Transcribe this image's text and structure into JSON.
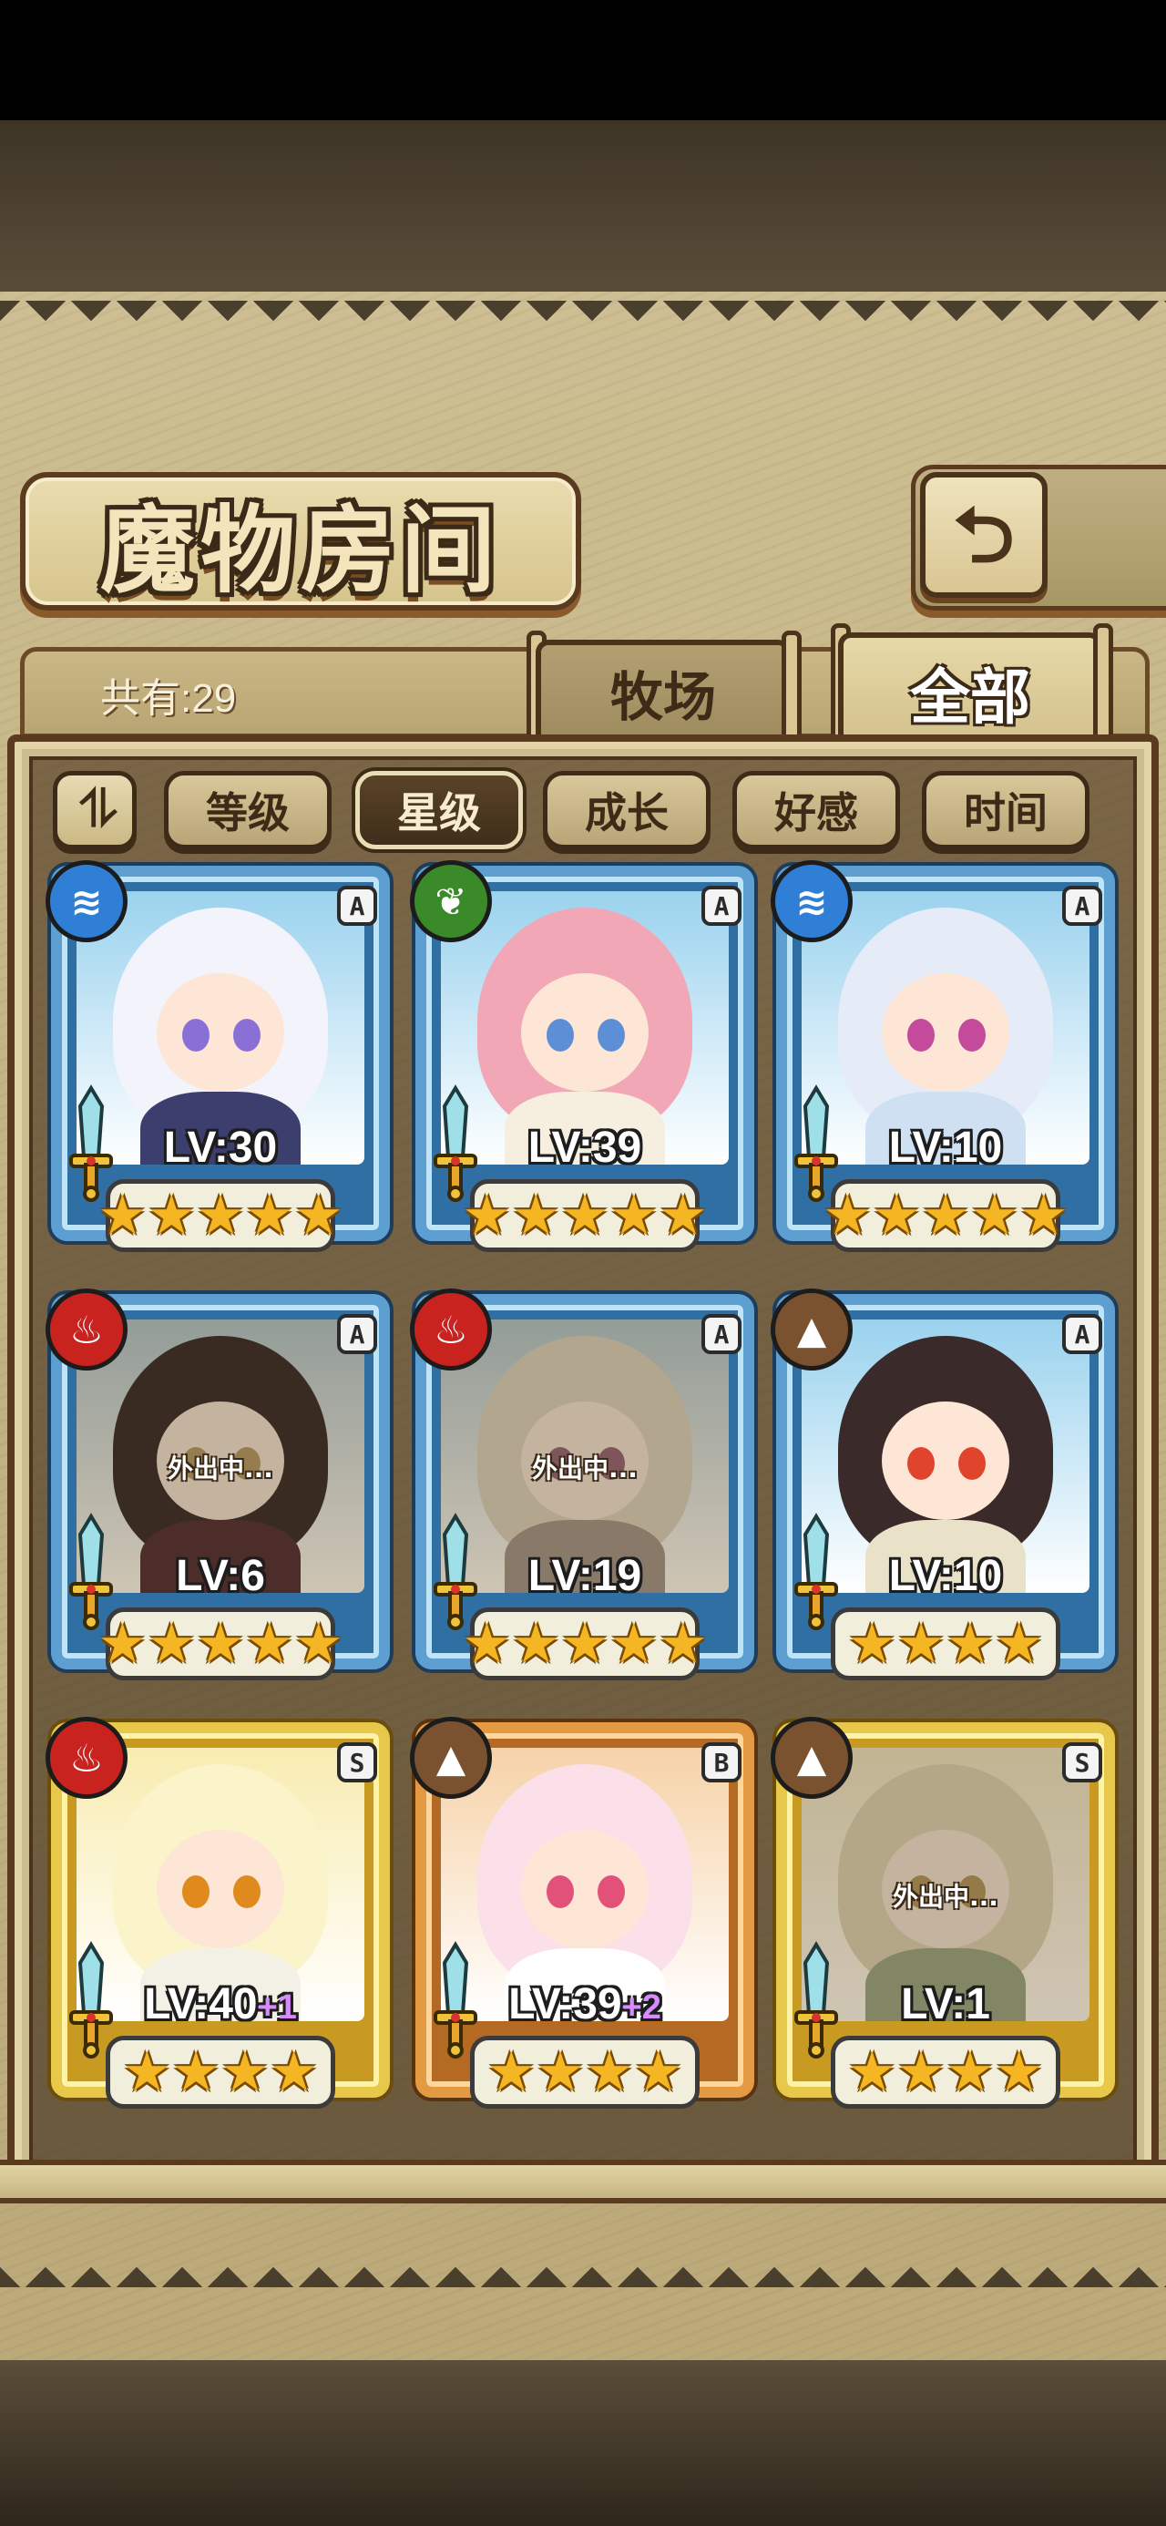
{
  "header": {
    "title": "魔物房间",
    "count_label": "共有:29"
  },
  "back_button": {
    "icon": "back-arrow-icon",
    "glyph": "⮌"
  },
  "tabs": [
    {
      "label": "牧场",
      "active": false
    },
    {
      "label": "全部",
      "active": true
    }
  ],
  "sort": {
    "toggle_glyph": "⥮",
    "buttons": [
      {
        "label": "等级",
        "active": false
      },
      {
        "label": "星级",
        "active": true
      },
      {
        "label": "成长",
        "active": false
      },
      {
        "label": "好感",
        "active": false
      },
      {
        "label": "时间",
        "active": false
      }
    ]
  },
  "elements": {
    "water": {
      "glyph": "≋",
      "color": "#2f7fd6"
    },
    "nature": {
      "glyph": "❦",
      "color": "#3b8a2a"
    },
    "fire": {
      "glyph": "♨",
      "color": "#c8231f"
    },
    "earth": {
      "glyph": "▲",
      "color": "#7a5230"
    }
  },
  "cards": [
    {
      "element": "water",
      "rank": "A",
      "level": "LV:30",
      "plus": "",
      "stars": 5,
      "away": "",
      "hair": "#f3f4fb",
      "eye": "#8a6fd6",
      "body": "#3c3f6d"
    },
    {
      "element": "nature",
      "rank": "A",
      "level": "LV:39",
      "plus": "",
      "stars": 5,
      "away": "",
      "hair": "#f2a7b6",
      "eye": "#5d8fd6",
      "body": "#f6efe0"
    },
    {
      "element": "water",
      "rank": "A",
      "level": "LV:10",
      "plus": "",
      "stars": 5,
      "away": "",
      "hair": "#e5ecf7",
      "eye": "#c44b9b",
      "body": "#cfe0f3"
    },
    {
      "element": "fire",
      "rank": "A",
      "level": "LV:6",
      "plus": "",
      "stars": 5,
      "away": "外出中...",
      "hair": "#5a3322",
      "eye": "#e0a02a",
      "body": "#8a2d2d"
    },
    {
      "element": "fire",
      "rank": "A",
      "level": "LV:19",
      "plus": "",
      "stars": 5,
      "away": "外出中...",
      "hair": "#e7d7b7",
      "eye": "#d05a8a",
      "body": "#b79a85"
    },
    {
      "element": "earth",
      "rank": "A",
      "level": "LV:10",
      "plus": "",
      "stars": 4,
      "away": "",
      "hair": "#3a2a2a",
      "eye": "#e0442c",
      "body": "#e9e2c8"
    },
    {
      "element": "fire",
      "rank": "S",
      "level": "LV:40",
      "plus": "+1",
      "stars": 4,
      "away": "",
      "hair": "#fbf3c9",
      "eye": "#e08a1e",
      "body": "#f3f0e6"
    },
    {
      "element": "earth",
      "rank": "B",
      "level": "LV:39",
      "plus": "+2",
      "stars": 4,
      "away": "",
      "hair": "#fbe0ea",
      "eye": "#e2517a",
      "body": "#fff"
    },
    {
      "element": "earth",
      "rank": "S",
      "level": "LV:1",
      "plus": "",
      "stars": 4,
      "away": "外出中...",
      "hair": "#e9d9a3",
      "eye": "#e09a1e",
      "body": "#9ab66c"
    }
  ]
}
